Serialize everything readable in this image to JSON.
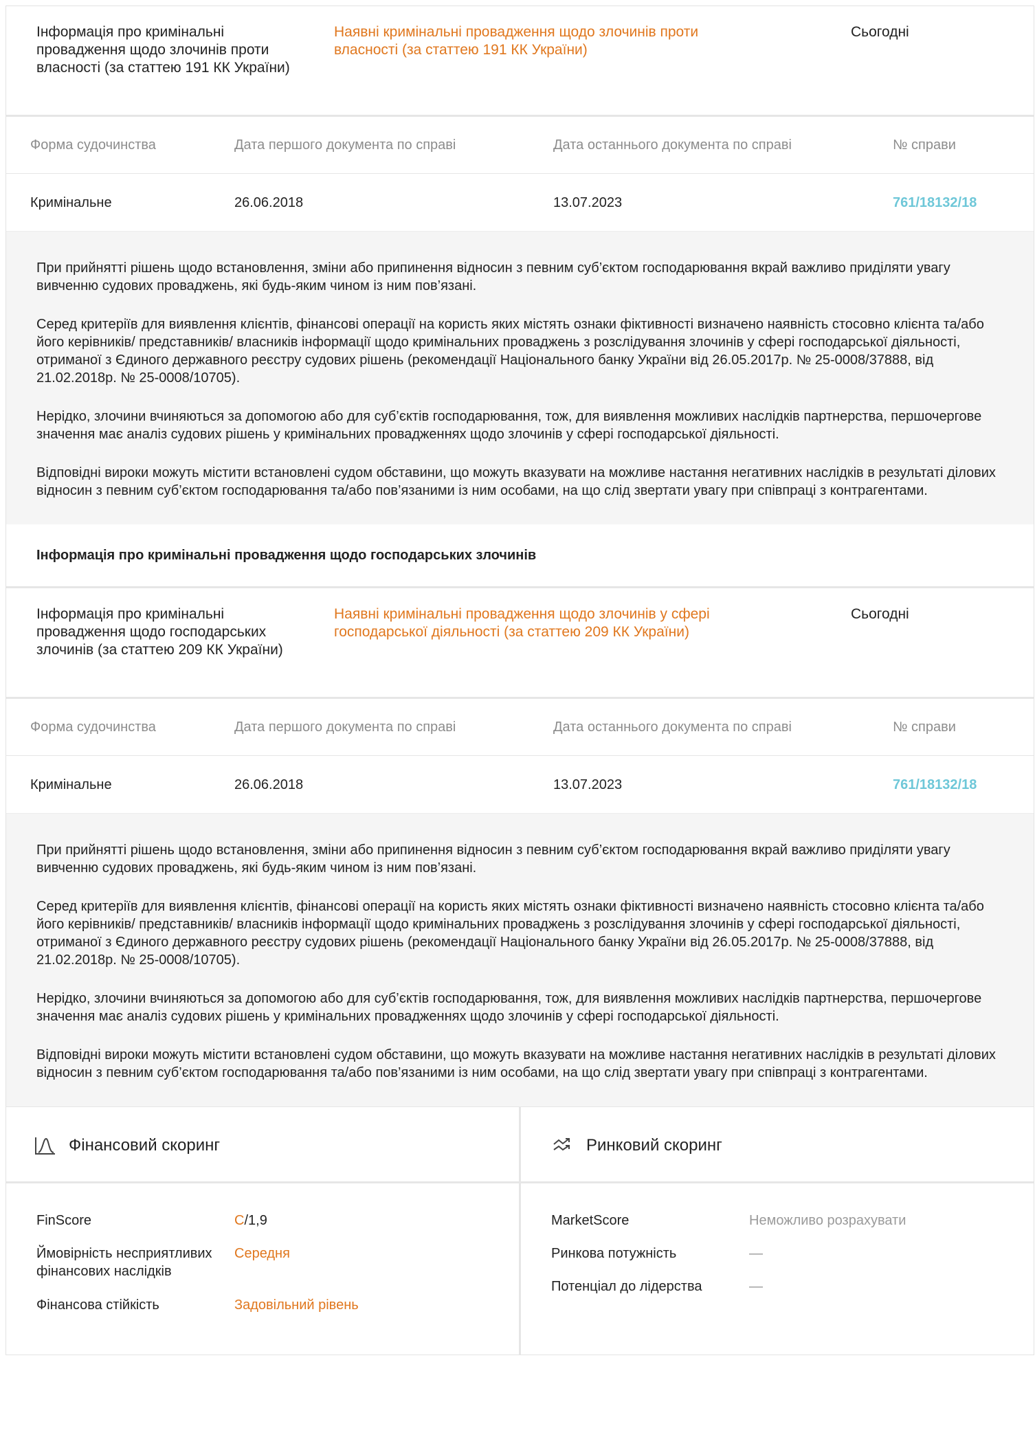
{
  "sections": [
    {
      "title": "",
      "head": {
        "label": "Інформація про кримінальні провадження щодо злочинів проти власності (за статтею 191 КК України)",
        "link": "Наявні кримінальні провадження щодо злочинів проти власності (за статтею 191 КК України)",
        "when": "Сьогодні"
      },
      "columns": [
        "Форма судочинства",
        "Дата першого документа по справі",
        "Дата останнього документа по справі",
        "№ справи"
      ],
      "row": {
        "form": "Кримінальне",
        "first": "26.06.2018",
        "last": "13.07.2023",
        "case": "761/18132/18"
      }
    },
    {
      "title": "Інформація про кримінальні провадження щодо господарських злочинів",
      "head": {
        "label": "Інформація про кримінальні провадження щодо господарських злочинів (за статтею 209 КК України)",
        "link": "Наявні кримінальні провадження щодо злочинів у сфері господарської діяльності (за статтею 209 КК України)",
        "when": "Сьогодні"
      },
      "columns": [
        "Форма судочинства",
        "Дата першого документа по справі",
        "Дата останнього документа по справі",
        "№ справи"
      ],
      "row": {
        "form": "Кримінальне",
        "first": "26.06.2018",
        "last": "13.07.2023",
        "case": "761/18132/18"
      }
    }
  ],
  "info_paragraphs": [
    "При прийнятті рішень щодо встановлення, зміни або припинення відносин з певним суб’єктом господарювання вкрай важливо приділяти увагу вивченню судових проваджень, які будь-яким чином із ним пов’язані.",
    "Серед критеріїв для виявлення клієнтів, фінансові операції на користь яких містять ознаки фіктивності визначено наявність стосовно клієнта та/або його керівників/ представників/ власників інформації щодо кримінальних проваджень з розслідування злочинів у сфері господарської діяльності, отриманої з Єдиного державного реєстру судових рішень (рекомендації Національного банку України від 26.05.2017р. № 25-0008/37888, від 21.02.2018р. № 25-0008/10705).",
    "Нерідко, злочини вчиняються за допомогою або для суб’єктів господарювання, тож, для виявлення можливих наслідків партнерства, першочергове значення має аналіз судових рішень у кримінальних провадженнях щодо злочинів у сфері господарської діяльності.",
    "Відповідні вироки можуть містити встановлені судом обставини, що можуть вказувати на можливе настання негативних наслідків в результаті ділових відносин з певним суб’єктом господарювання та/або пов’язаними із ним особами, на що слід звертати увагу при співпраці з контрагентами."
  ],
  "financial": {
    "title": "Фінансовий скоринг",
    "icon": "chart-peak-icon",
    "finscore_label": "FinScore",
    "finscore_grade": "C",
    "finscore_value": "/1,9",
    "prob_label": "Ймовірність несприятливих фінансових наслідків",
    "prob_value": "Середня",
    "stab_label": "Фінансова стійкість",
    "stab_value": "Задовільний рівень",
    "accent_color": "#e0771e"
  },
  "market": {
    "title": "Ринковий скоринг",
    "icon": "trend-arrows-icon",
    "score_label": "MarketScore",
    "score_value": "Неможливо розрахувати",
    "power_label": "Ринкова потужність",
    "power_value": "—",
    "lead_label": "Потенціал до лідерства",
    "lead_value": "—"
  },
  "colors": {
    "link": "#e0771e",
    "case": "#6ec7d8",
    "muted": "#8c8c8c",
    "panel_bg": "#f5f5f5"
  }
}
